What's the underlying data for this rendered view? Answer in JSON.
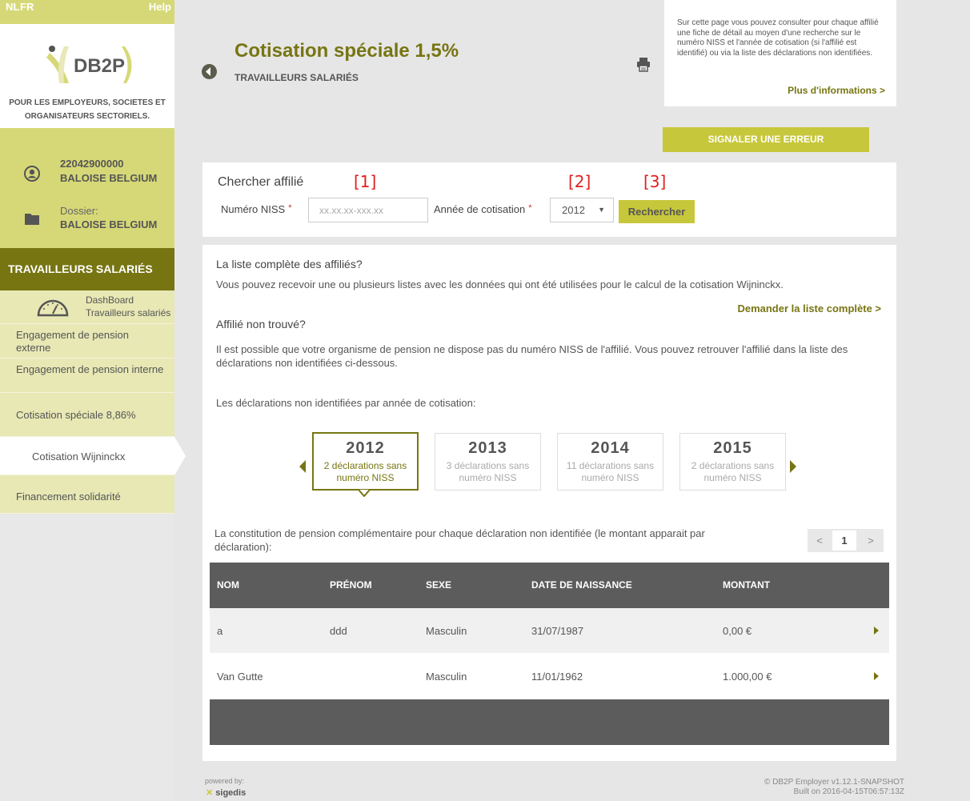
{
  "lang": {
    "nl": "NL",
    "fr": "FR",
    "help": "Help"
  },
  "logo": {
    "text": "DB2P",
    "tagline": "POUR LES EMPLOYEURS, SOCIETES ET ORGANISATEURS SECTORIELS."
  },
  "account": {
    "number": "22042900000",
    "company": "BALOISE BELGIUM",
    "dossier_label": "Dossier:",
    "dossier_value": "BALOISE BELGIUM"
  },
  "nav": {
    "header": "TRAVAILLEURS SALARIÉS",
    "dashboard_l1": "DashBoard",
    "dashboard_l2": "Travailleurs salariés",
    "items": [
      "Engagement de pension externe",
      "Engagement de pension interne",
      "Cotisation spéciale 8,86%",
      "Cotisation Wijninckx",
      "Financement solidarité"
    ]
  },
  "header": {
    "title": "Cotisation spéciale 1,5%",
    "subtitle": "TRAVAILLEURS SALARIÉS"
  },
  "info": {
    "text": "Sur cette page vous pouvez consulter pour chaque affilié une fiche de détail au moyen d'une recherche sur le numéro NISS et l'année de cotisation (si l'affilié est identifié) ou via la liste des déclarations non identifiées.",
    "link": "Plus d'informations >"
  },
  "report_error": "SIGNALER UNE ERREUR",
  "search": {
    "title": "Chercher affilié",
    "annot_1": "[1]",
    "annot_2": "[2]",
    "annot_3": "[3]",
    "niss_label": "Numéro NISS",
    "required": "*",
    "niss_placeholder": "xx.xx.xx-xxx.xx",
    "year_label": "Année de cotisation",
    "year_value": "2012",
    "button": "Rechercher"
  },
  "main": {
    "full_list_q": "La liste complète des affiliés?",
    "full_list_desc": "Vous pouvez recevoir une ou plusieurs listes avec les données qui ont été utilisées pour le calcul de la cotisation Wijninckx.",
    "full_list_link": "Demander la liste complète >",
    "not_found_q": "Affilié non trouvé?",
    "not_found_desc": "Il est possible que votre organisme de pension ne dispose pas du numéro NISS de l'affilié. Vous pouvez retrouver l'affilié dans la liste des déclarations non identifiées ci-dessous.",
    "decl_label": "Les déclarations non identifiées par année de cotisation:",
    "years": [
      {
        "year": "2012",
        "desc": "2 déclarations sans numéro NISS"
      },
      {
        "year": "2013",
        "desc": "3 déclarations sans numéro NISS"
      },
      {
        "year": "2014",
        "desc": "11 déclarations sans numéro NISS"
      },
      {
        "year": "2015",
        "desc": "2 déclarations sans numéro NISS"
      }
    ],
    "breakdown_label": "La constitution de pension complémentaire pour chaque déclaration non identifiée (le montant apparait par déclaration):",
    "pager": {
      "prev": "<",
      "page": "1",
      "next": ">"
    }
  },
  "table": {
    "headers": [
      "NOM",
      "PRÉNOM",
      "SEXE",
      "DATE DE NAISSANCE",
      "MONTANT"
    ],
    "rows": [
      {
        "nom": "a",
        "prenom": "ddd",
        "sexe": "Masculin",
        "naissance": "31/07/1987",
        "montant": "0,00 €"
      },
      {
        "nom": "Van Gutte",
        "prenom": "",
        "sexe": "Masculin",
        "naissance": "11/01/1962",
        "montant": "1.000,00 €"
      }
    ]
  },
  "footer": {
    "powered": "powered by:",
    "sigedis": "sigedis",
    "version": "© DB2P Employer v1.12.1-SNAPSHOT",
    "built": "Built on 2016-04-15T06:57:13Z"
  },
  "colors": {
    "olive": "#777512",
    "lime": "#d6d877",
    "button": "#c7c73b",
    "table_header": "#5c5c5c"
  }
}
